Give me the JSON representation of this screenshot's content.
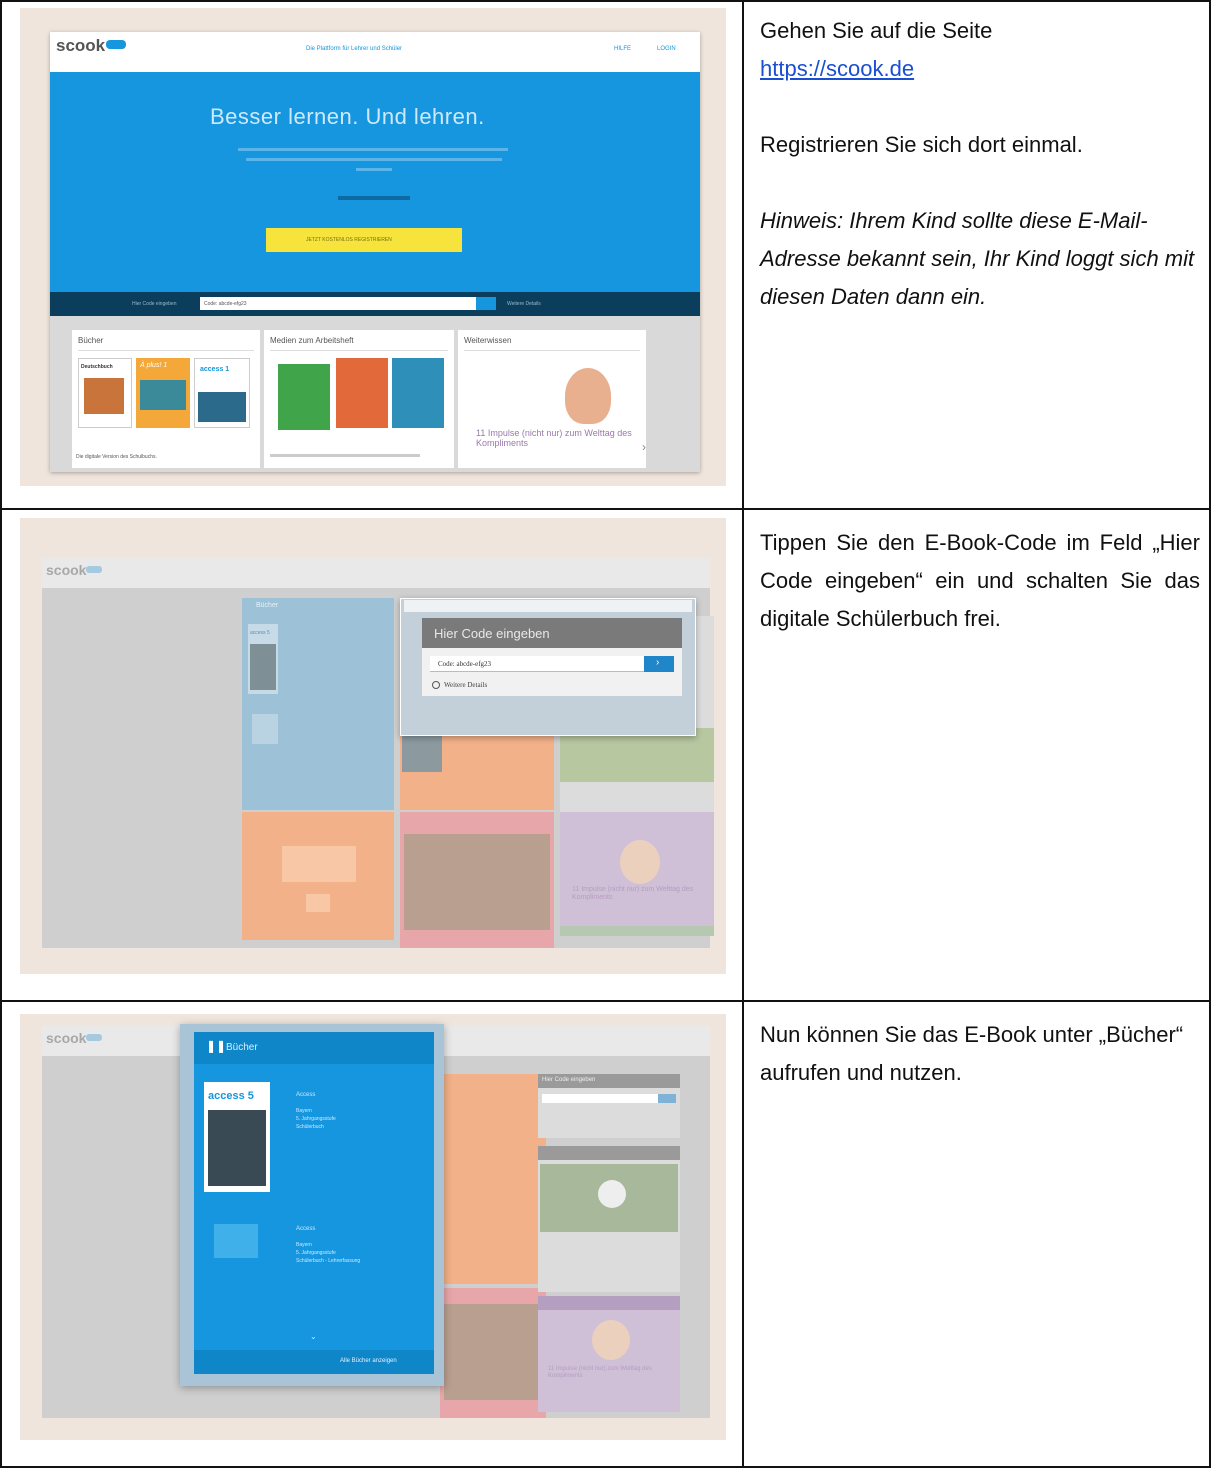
{
  "rows": [
    {
      "text": {
        "line1": "Gehen Sie auf die Seite",
        "link": "https://scook.de",
        "para2": "Registrieren Sie sich dort einmal.",
        "hint": "Hinweis: Ihrem Kind sollte diese E-Mail-Adresse bekannt sein, Ihr Kind loggt sich mit diesen Daten dann ein."
      },
      "shot": {
        "logo": "scook",
        "tagline": "Die Plattform für Lehrer und Schüler",
        "nav_help": "HILFE",
        "nav_login": "LOGIN",
        "hero": "Besser lernen. Und lehren.",
        "register_button": "JETZT KOSTENLOS REGISTRIEREN",
        "code_label": "Hier Code eingeben",
        "code_value": "Code: abcde-efg23",
        "more_details": "Weitere Details",
        "card_books": "Bücher",
        "card_media": "Medien zum Arbeitsheft",
        "card_further": "Weiterwissen",
        "books_caption": "Die digitale Version des Schulbuchs.",
        "cover_deutschbuch": "Deutschbuch",
        "cover_access": "access 1",
        "cover_aplus": "À plus! 1",
        "further_title": "11 Impulse (nicht nur) zum Welttag des Kompliments"
      }
    },
    {
      "text": {
        "para": "Tippen Sie den E-Book-Code im Feld „Hier Code eingeben“ ein und schalten Sie das digitale Schülerbuch frei."
      },
      "shot": {
        "logo": "scook",
        "panel_title": "Hier Code eingeben",
        "code_value": "Code: abcde-efg23",
        "more_details": "Weitere Details",
        "card_books": "Bücher",
        "cover_access": "access 5",
        "further_title": "11 Impulse (nicht nur) zum Welttag des Kompliments"
      }
    },
    {
      "text": {
        "para": "Nun können Sie das E-Book unter „Bücher“ aufrufen und nutzen."
      },
      "shot": {
        "logo": "scook",
        "panel_title": "Bücher",
        "cover_access": "access 5",
        "book1_title": "Access",
        "book1_line1": "Bayern",
        "book1_line2": "5. Jahrgangsstufe",
        "book1_line3": "Schülerbuch",
        "book2_title": "Access",
        "book2_line1": "Bayern",
        "book2_line2": "5. Jahrgangsstufe",
        "book2_line3": "Schülerbuch - Lehrerfassung",
        "show_all": "Alle Bücher anzeigen",
        "side_code_title": "Hier Code eingeben",
        "further_title": "11 Impulse (nicht nur) zum Welttag des Kompliments"
      }
    }
  ],
  "colors": {
    "scook_blue": "#1596de",
    "dark_bar": "#0b3e5c",
    "yellow": "#f6e43c",
    "orange": "#f08c5a",
    "pink": "#d96a72",
    "purple": "#9a78ab",
    "link": "#1a4fd1"
  }
}
